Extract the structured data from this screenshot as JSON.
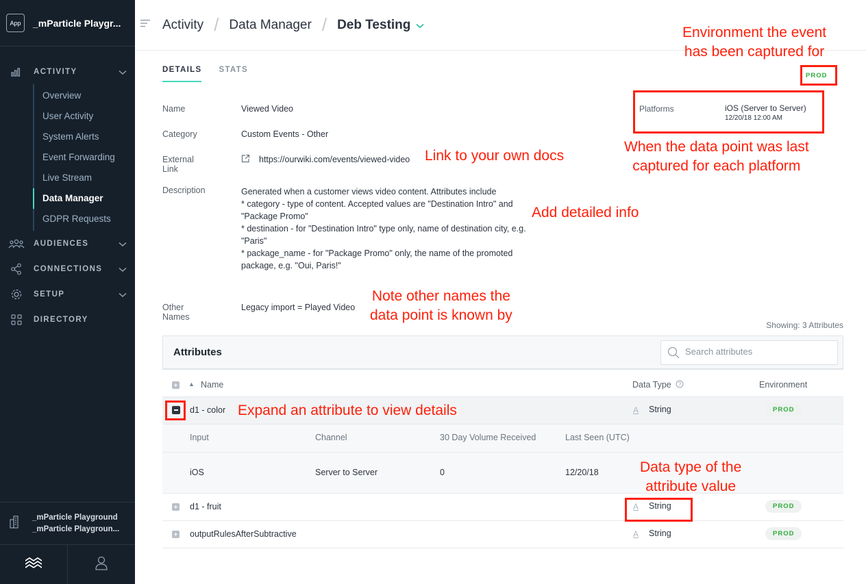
{
  "app": {
    "badge": "App",
    "name": "_mParticle Playgr..."
  },
  "nav": {
    "activity": "ACTIVITY",
    "sub_items": [
      "Overview",
      "User Activity",
      "System Alerts",
      "Event Forwarding",
      "Live Stream",
      "Data Manager",
      "GDPR Requests"
    ],
    "active_item": "Data Manager",
    "audiences": "AUDIENCES",
    "connections": "CONNECTIONS",
    "setup": "SETUP",
    "directory": "DIRECTORY"
  },
  "workspace": {
    "line1": "_mParticle Playground",
    "line2": "_mParticle Playgroun..."
  },
  "breadcrumb": {
    "c1": "Activity",
    "c2": "Data Manager",
    "c3": "Deb Testing",
    "sep": "/"
  },
  "tabs": {
    "details": "DETAILS",
    "stats": "STATS"
  },
  "details": {
    "name_label": "Name",
    "name_value": "Viewed Video",
    "category_label": "Category",
    "category_value": "Custom Events - Other",
    "link_label": "External Link",
    "link_value": "https://ourwiki.com/events/viewed-video",
    "description_label": "Description",
    "description_lines": [
      "Generated when a customer views video content. Attributes include",
      "* category - type of content. Accepted values are \"Destination Intro\" and",
      "\"Package Promo\"",
      "* destination - for \"Destination Intro\" type only, name of destination city, e.g.",
      "\"Paris\"",
      "* package_name - for \"Package Promo\" only, the name of the promoted",
      "package, e.g. \"Oui, Paris!\""
    ],
    "other_names_label": "Other Names",
    "other_names_value": "Legacy import = Played Video",
    "environment": "PROD",
    "platforms_label": "Platforms",
    "platform_value": "iOS (Server to Server)",
    "platform_last_seen": "12/20/18 12:00 AM"
  },
  "showing": "Showing: 3 Attributes",
  "attributes": {
    "title": "Attributes",
    "search_placeholder": "Search attributes",
    "col_name": "Name",
    "col_type": "Data Type",
    "col_env": "Environment",
    "rows": [
      {
        "name": "d1 - color",
        "type": "String",
        "env": "PROD"
      },
      {
        "name": "d1 - fruit",
        "type": "String",
        "env": "PROD"
      },
      {
        "name": "outputRulesAfterSubtractive",
        "type": "String",
        "env": "PROD"
      }
    ],
    "detail_headers": [
      "Input",
      "Channel",
      "30 Day Volume Received",
      "Last Seen (UTC)"
    ],
    "detail_row": [
      "iOS",
      "Server to Server",
      "0",
      "12/20/18"
    ],
    "type_icon": "A"
  },
  "callouts": {
    "env1": "Environment the event",
    "env2": "has been captured for",
    "last1": "When the data point was last",
    "last2": "captured for each platform",
    "link": "Link to your own docs",
    "info": "Add detailed info",
    "names1": "Note other names the",
    "names2": "data point is known by",
    "expand": "Expand an attribute to view details",
    "dtype1": "Data type of the",
    "dtype2": "attribute value"
  },
  "colors": {
    "accent": "#44d8bd",
    "sidebar": "#16202b",
    "annotation": "#ff1f0a",
    "prod": "#2fae3c"
  }
}
